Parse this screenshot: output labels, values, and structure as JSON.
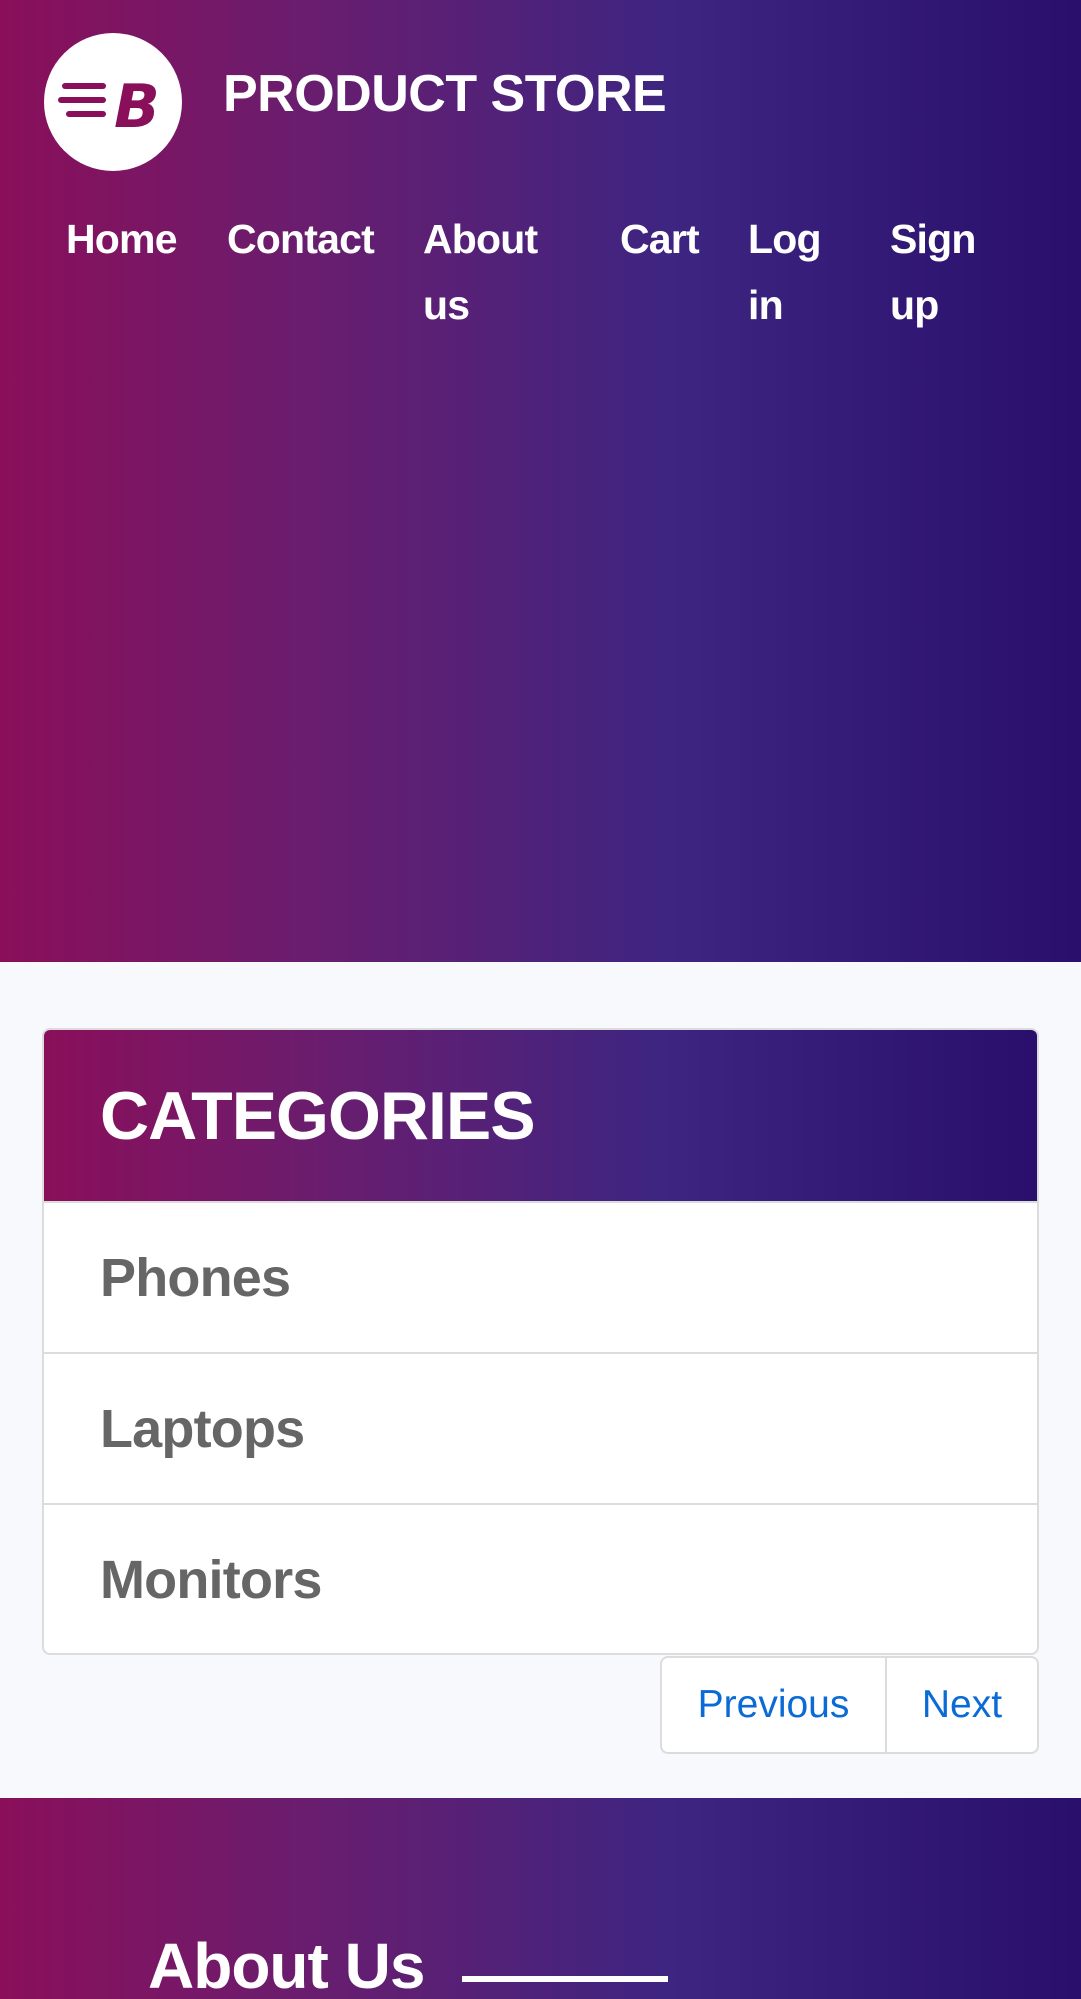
{
  "header": {
    "brand": "PRODUCT STORE",
    "logo_letter": "B",
    "nav": [
      "Home",
      "Contact",
      "About us",
      "Cart",
      "Log in",
      "Sign up"
    ]
  },
  "categories": {
    "title": "CATEGORIES",
    "items": [
      "Phones",
      "Laptops",
      "Monitors"
    ]
  },
  "pagination": {
    "previous": "Previous",
    "next": "Next"
  },
  "footer": {
    "about_title": "About Us"
  },
  "colors": {
    "gradient_start": "#8a0f5a",
    "gradient_end": "#2a0f6c",
    "link": "#0a6bd6",
    "category_text": "#666666"
  }
}
